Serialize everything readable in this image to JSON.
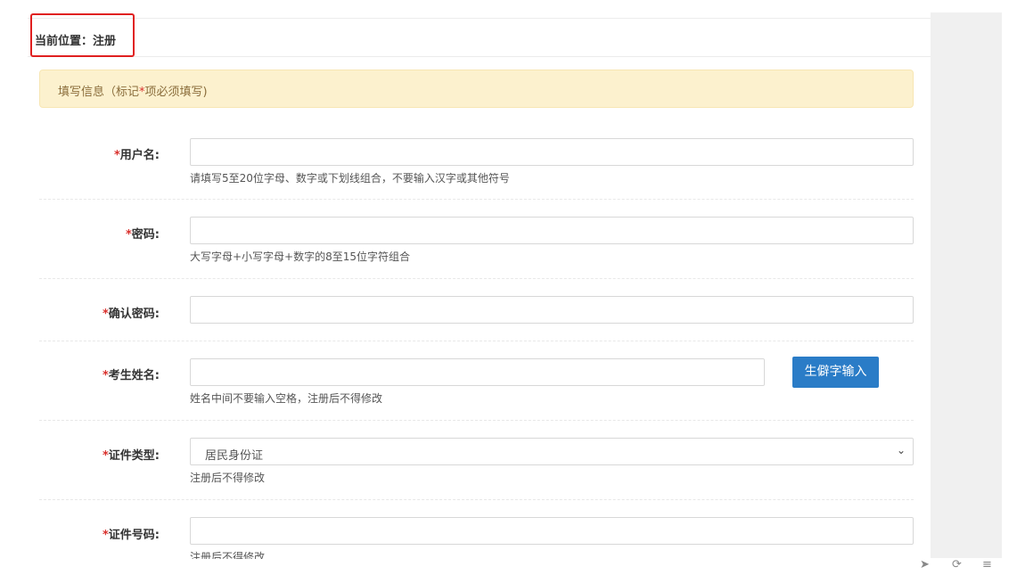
{
  "breadcrumb": {
    "text": "当前位置：注册"
  },
  "notice": {
    "prefix": "填写信息（标记",
    "star": "*",
    "suffix": "项必须填写)"
  },
  "fields": [
    {
      "star": "*",
      "label": "用户名:",
      "hint": "请填写5至20位字母、数字或下划线组合，不要输入汉字或其他符号"
    },
    {
      "star": "*",
      "label": "密码:",
      "hint": "大写字母+小写字母+数字的8至15位字符组合"
    },
    {
      "star": "*",
      "label": "确认密码:",
      "hint": ""
    },
    {
      "star": "*",
      "label": "考生姓名:",
      "hint": "姓名中间不要输入空格，注册后不得修改",
      "button": "生僻字输入"
    },
    {
      "star": "*",
      "label": "证件类型:",
      "hint": "注册后不得修改",
      "select_value": "居民身份证"
    },
    {
      "star": "*",
      "label": "证件号码:",
      "hint": "注册后不得修改"
    }
  ],
  "colors": {
    "accent": "#2a7cc7",
    "required": "#d9302c",
    "notice_bg": "#fcf1ce",
    "highlight": "#e02020"
  },
  "icons": [
    "send-icon",
    "refresh-icon",
    "trash-icon"
  ]
}
